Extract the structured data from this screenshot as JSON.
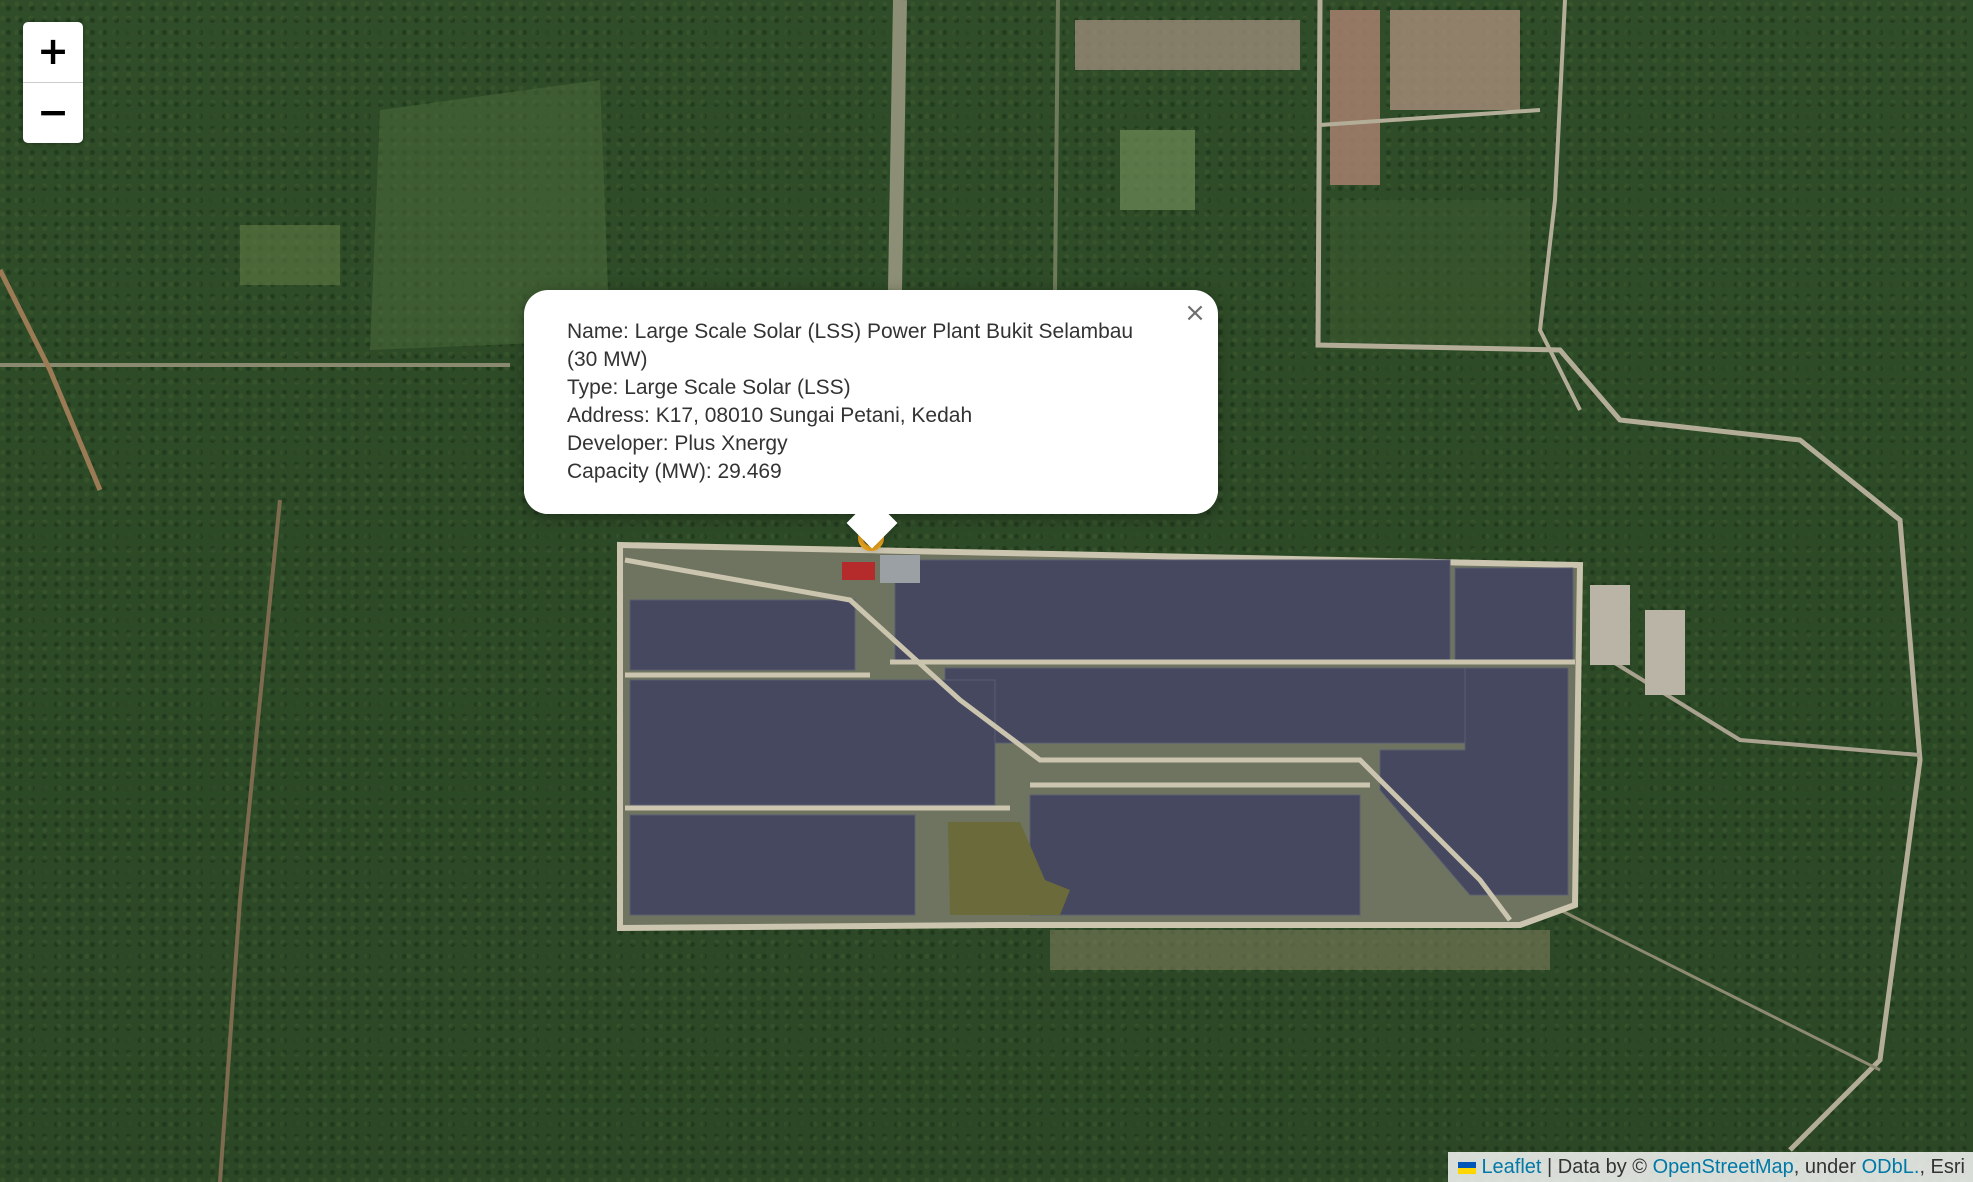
{
  "map": {
    "basemap": "satellite",
    "colors": {
      "forest": "#2e4b27",
      "panels": "#4a4d63",
      "roads": "#c9c1ac",
      "marker": "#f0a81e",
      "roofs": "#b87a6a"
    }
  },
  "zoom_control": {
    "zoom_in_label": "+",
    "zoom_out_label": "−"
  },
  "popup": {
    "close_label": "×",
    "lines": [
      "Name: Large Scale Solar (LSS) Power Plant Bukit Selambau (30 MW)",
      "Type: Large Scale Solar (LSS)",
      "Address: K17, 08010 Sungai Petani, Kedah",
      "Developer: Plus Xnergy",
      "Capacity (MW): 29.469"
    ]
  },
  "attribution": {
    "leaflet": "Leaflet",
    "sep1": " | Data by © ",
    "osm": "OpenStreetMap",
    "sep2": ", under ",
    "odbl": "ODbL.",
    "sep3": ", Esri"
  }
}
